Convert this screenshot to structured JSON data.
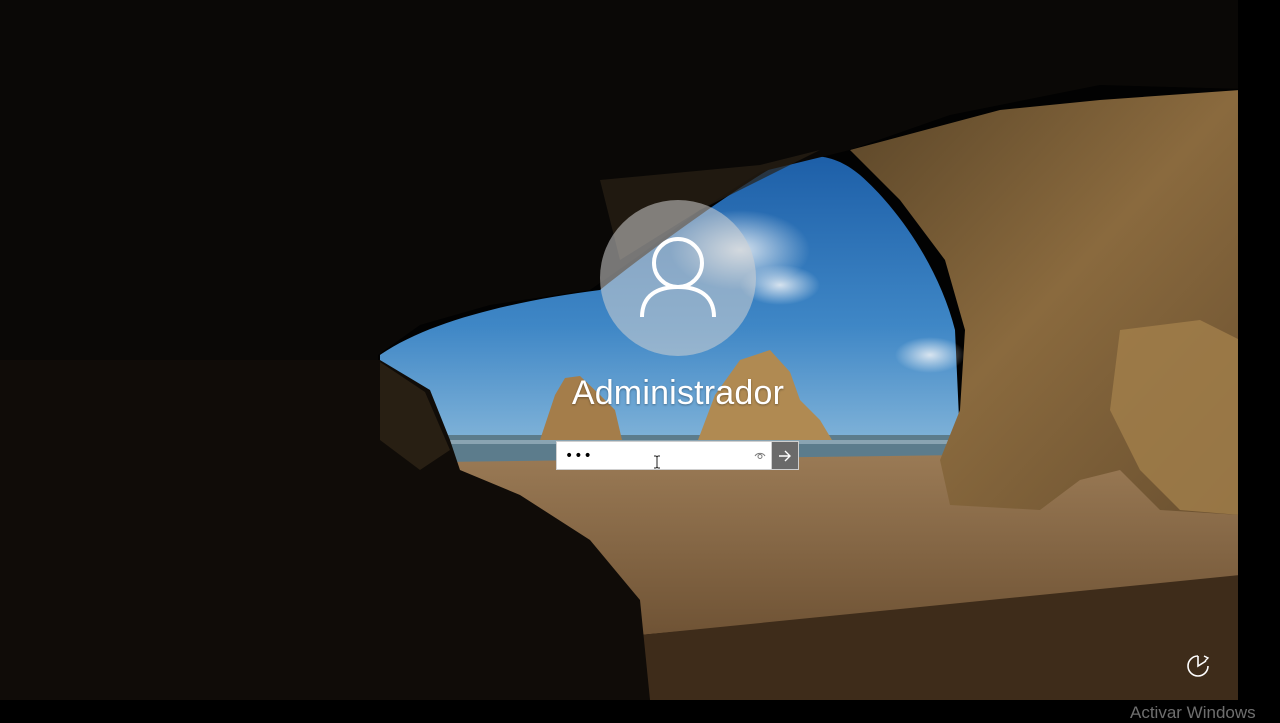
{
  "lock_screen": {
    "username": "Administrador",
    "password": {
      "value": "•••",
      "placeholder": "",
      "reveal_icon": "eye-icon",
      "submit_icon": "arrow-right-icon"
    },
    "corner_icon": "ease-of-access-icon",
    "background": "sea-cave-beach-photo",
    "watermark": "Activar Windows"
  },
  "colors": {
    "avatar_circle": "#d2d2d2",
    "submit_button": "#6a6a6a",
    "text": "#ffffff"
  }
}
